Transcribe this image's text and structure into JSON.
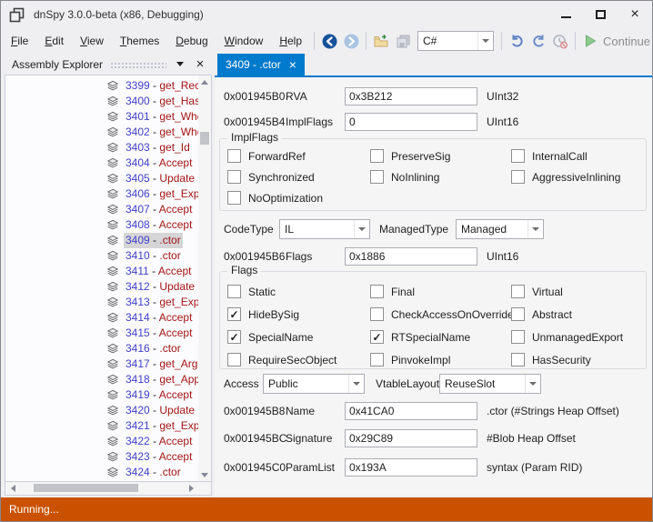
{
  "window": {
    "title": "dnSpy 3.0.0-beta (x86, Debugging)"
  },
  "menu_bar": {
    "items": [
      "File",
      "Edit",
      "View",
      "Themes",
      "Debug",
      "Window",
      "Help"
    ]
  },
  "toolbar": {
    "language_combo": {
      "value": "C#"
    },
    "continue_button": {
      "label": "Continue"
    }
  },
  "assembly_explorer": {
    "title": "Assembly Explorer",
    "selected_id": "3409",
    "separator": " - ",
    "items": [
      {
        "id": "3399",
        "name": "get_Rece"
      },
      {
        "id": "3400",
        "name": "get_HasV"
      },
      {
        "id": "3401",
        "name": "get_Wher"
      },
      {
        "id": "3402",
        "name": "get_Wher"
      },
      {
        "id": "3403",
        "name": "get_Id"
      },
      {
        "id": "3404",
        "name": "Accept"
      },
      {
        "id": "3405",
        "name": "Update"
      },
      {
        "id": "3406",
        "name": "get_Expre"
      },
      {
        "id": "3407",
        "name": "Accept"
      },
      {
        "id": "3408",
        "name": "Accept"
      },
      {
        "id": "3409",
        "name": ".ctor"
      },
      {
        "id": "3410",
        "name": ".ctor"
      },
      {
        "id": "3411",
        "name": "Accept"
      },
      {
        "id": "3412",
        "name": "Update"
      },
      {
        "id": "3413",
        "name": "get_Expre"
      },
      {
        "id": "3414",
        "name": "Accept"
      },
      {
        "id": "3415",
        "name": "Accept"
      },
      {
        "id": "3416",
        "name": ".ctor"
      },
      {
        "id": "3417",
        "name": "get_Argu"
      },
      {
        "id": "3418",
        "name": "get_Appl"
      },
      {
        "id": "3419",
        "name": "Accept"
      },
      {
        "id": "3420",
        "name": "Update"
      },
      {
        "id": "3421",
        "name": "get_Expre"
      },
      {
        "id": "3422",
        "name": "Accept"
      },
      {
        "id": "3423",
        "name": "Accept"
      },
      {
        "id": "3424",
        "name": ".ctor"
      }
    ]
  },
  "editor": {
    "tab": {
      "label": "3409 - .ctor"
    },
    "fields": {
      "rva": {
        "address": "0x001945B0",
        "label": "RVA",
        "value": "0x3B212",
        "suffix": "UInt32"
      },
      "implflags": {
        "address": "0x001945B4",
        "label": "ImplFlags",
        "value": "0",
        "suffix": "UInt16"
      },
      "flags": {
        "address": "0x001945B6",
        "label": "Flags",
        "value": "0x1886",
        "suffix": "UInt16"
      },
      "name": {
        "address": "0x001945B8",
        "label": "Name",
        "value": "0x41CA0",
        "suffix": ".ctor (#Strings Heap Offset)"
      },
      "signature": {
        "address": "0x001945BC",
        "label": "Signature",
        "value": "0x29C89",
        "suffix": "#Blob Heap Offset"
      },
      "paramlist": {
        "address": "0x001945C0",
        "label": "ParamList",
        "value": "0x193A",
        "suffix": "syntax (Param RID)"
      }
    },
    "implflags_group": {
      "title": "ImplFlags",
      "checkboxes": [
        {
          "label": "ForwardRef",
          "checked": false
        },
        {
          "label": "PreserveSig",
          "checked": false
        },
        {
          "label": "InternalCall",
          "checked": false
        },
        {
          "label": "Synchronized",
          "checked": false
        },
        {
          "label": "NoInlining",
          "checked": false
        },
        {
          "label": "AggressiveInlining",
          "checked": false
        },
        {
          "label": "NoOptimization",
          "checked": false
        }
      ]
    },
    "codetype_row": {
      "label1": "CodeType",
      "value1": "IL",
      "label2": "ManagedType",
      "value2": "Managed"
    },
    "flags_group": {
      "title": "Flags",
      "checkboxes": [
        {
          "label": "Static",
          "checked": false
        },
        {
          "label": "Final",
          "checked": false
        },
        {
          "label": "Virtual",
          "checked": false
        },
        {
          "label": "HideBySig",
          "checked": true
        },
        {
          "label": "CheckAccessOnOverride",
          "checked": false
        },
        {
          "label": "Abstract",
          "checked": false
        },
        {
          "label": "SpecialName",
          "checked": true
        },
        {
          "label": "RTSpecialName",
          "checked": true
        },
        {
          "label": "UnmanagedExport",
          "checked": false
        },
        {
          "label": "RequireSecObject",
          "checked": false
        },
        {
          "label": "PinvokeImpl",
          "checked": false
        },
        {
          "label": "HasSecurity",
          "checked": false
        }
      ]
    },
    "access_row": {
      "label1": "Access",
      "value1": "Public",
      "label2": "VtableLayout",
      "value2": "ReuseSlot"
    }
  },
  "status_bar": {
    "text": "Running...",
    "color": "#CA5100"
  }
}
